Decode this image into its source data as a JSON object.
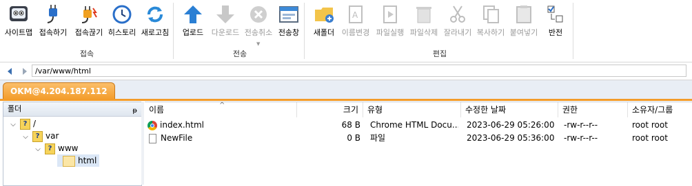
{
  "ribbon": {
    "groups": [
      {
        "label": "접속",
        "buttons": [
          {
            "label": "사이트맵",
            "icon": "site-map-icon",
            "disabled": false
          },
          {
            "label": "접속하기",
            "icon": "connect-plug-icon",
            "disabled": false
          },
          {
            "label": "접속끊기",
            "icon": "disconnect-plug-icon",
            "disabled": false
          },
          {
            "label": "히스토리",
            "icon": "history-clock-icon",
            "disabled": false
          },
          {
            "label": "새로고침",
            "icon": "refresh-icon",
            "disabled": false
          }
        ]
      },
      {
        "label": "전송",
        "buttons": [
          {
            "label": "업로드",
            "icon": "upload-arrow-icon",
            "disabled": false
          },
          {
            "label": "다운로드",
            "icon": "download-arrow-icon",
            "disabled": true
          },
          {
            "label": "전송취소",
            "icon": "cancel-transfer-icon",
            "disabled": true
          },
          {
            "label": "전송창",
            "icon": "transfer-window-icon",
            "disabled": false
          }
        ]
      },
      {
        "label": "편집",
        "buttons": [
          {
            "label": "새폴더",
            "icon": "new-folder-icon",
            "disabled": false
          },
          {
            "label": "이름변경",
            "icon": "rename-icon",
            "disabled": true
          },
          {
            "label": "파일실행",
            "icon": "run-file-icon",
            "disabled": true
          },
          {
            "label": "파일삭제",
            "icon": "delete-file-icon",
            "disabled": true
          },
          {
            "label": "잘라내기",
            "icon": "cut-icon",
            "disabled": true
          },
          {
            "label": "복사하기",
            "icon": "copy-icon",
            "disabled": true
          },
          {
            "label": "붙여넣기",
            "icon": "paste-icon",
            "disabled": true
          },
          {
            "label": "반전",
            "icon": "invert-selection-icon",
            "disabled": false
          }
        ]
      }
    ]
  },
  "address": {
    "path": "/var/www/html"
  },
  "tab": {
    "label": "OKM@4.204.187.112"
  },
  "folder_pane": {
    "title": "폴더",
    "tree": [
      {
        "label": "/"
      },
      {
        "label": "var"
      },
      {
        "label": "www"
      },
      {
        "label": "html"
      }
    ]
  },
  "file_list": {
    "columns": [
      "이름",
      "크기",
      "유형",
      "수정한 날짜",
      "권한",
      "소유자/그룹"
    ],
    "rows": [
      {
        "name": "index.html",
        "size": "68 B",
        "type": "Chrome HTML Docu...",
        "modified": "2023-06-29 05:26:00",
        "perm": "-rw-r--r--",
        "owner": "root root",
        "icon": "chrome-icon"
      },
      {
        "name": "NewFile",
        "size": "0 B",
        "type": "파일",
        "modified": "2023-06-29 05:36:00",
        "perm": "-rw-r--r--",
        "owner": "root root",
        "icon": "file-icon"
      }
    ]
  },
  "colors": {
    "accent_tab": "#f39c2a",
    "disabled_text": "#9a9a9a",
    "blue_icon": "#2a7fd4"
  }
}
